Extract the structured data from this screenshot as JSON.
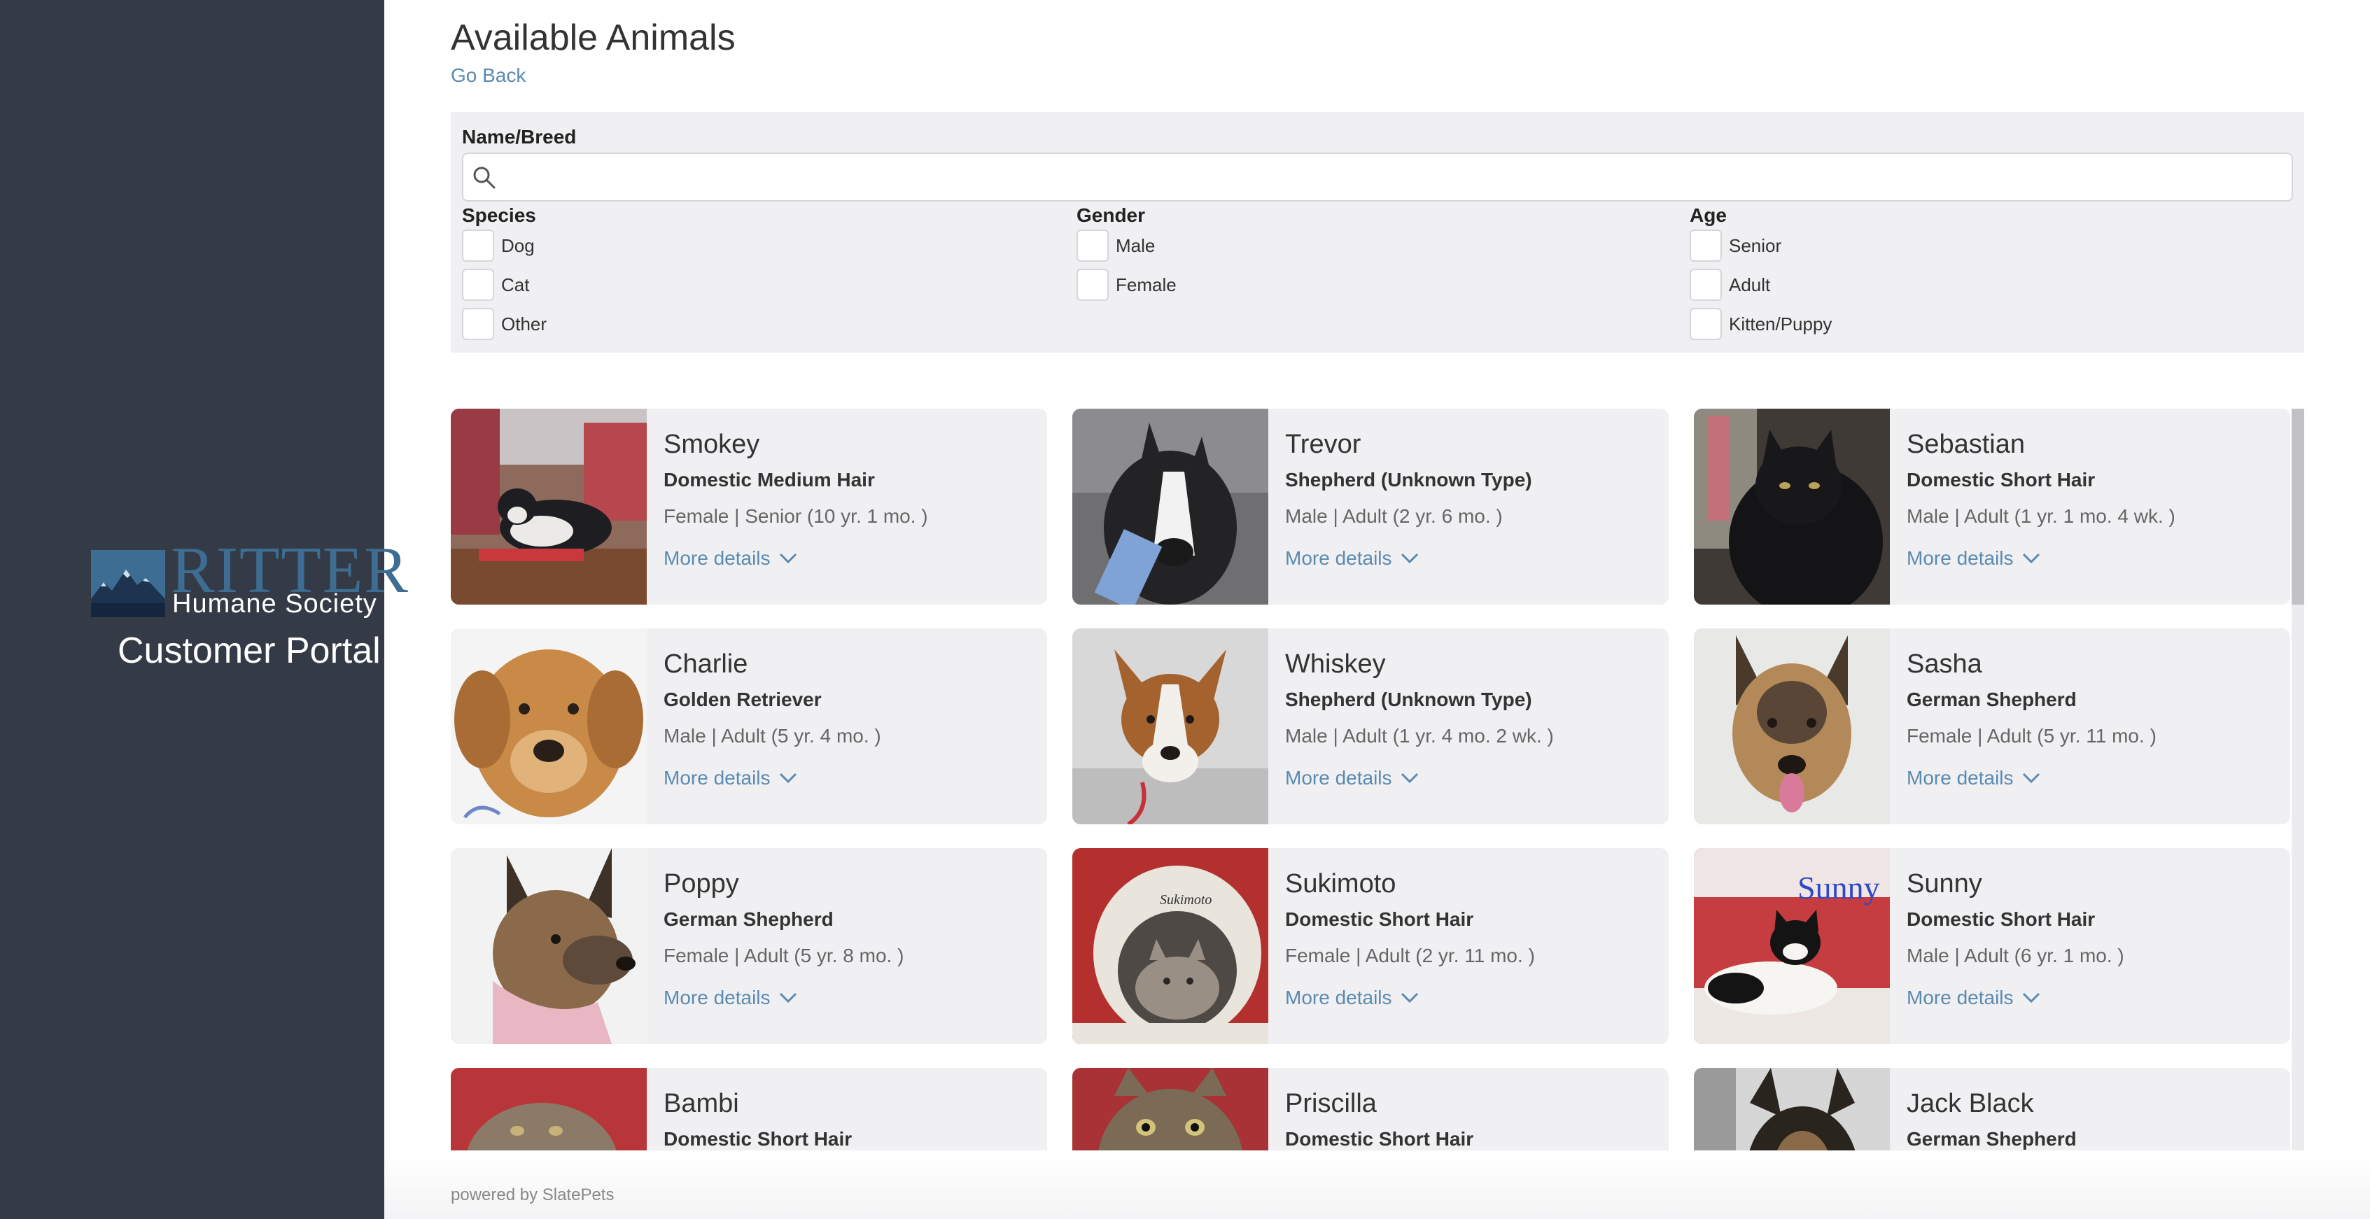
{
  "sidebar": {
    "logo_ritter": "RITTER",
    "logo_humane": "Humane Society",
    "portal_title": "Customer Portal"
  },
  "header": {
    "title": "Available Animals",
    "go_back": "Go Back"
  },
  "filters": {
    "name_breed_label": "Name/Breed",
    "search_placeholder": "",
    "species_label": "Species",
    "species_options": [
      "Dog",
      "Cat",
      "Other"
    ],
    "gender_label": "Gender",
    "gender_options": [
      "Male",
      "Female"
    ],
    "age_label": "Age",
    "age_options": [
      "Senior",
      "Adult",
      "Kitten/Puppy"
    ]
  },
  "more_details_label": "More details",
  "animals": [
    {
      "name": "Smokey",
      "breed": "Domestic Medium Hair",
      "info": "Female | Senior (10 yr. 1 mo. )"
    },
    {
      "name": "Trevor",
      "breed": "Shepherd (Unknown Type)",
      "info": "Male | Adult (2 yr. 6 mo. )"
    },
    {
      "name": "Sebastian",
      "breed": "Domestic Short Hair",
      "info": "Male | Adult (1 yr. 1 mo. 4 wk. )"
    },
    {
      "name": "Charlie",
      "breed": "Golden Retriever",
      "info": "Male | Adult (5 yr. 4 mo. )"
    },
    {
      "name": "Whiskey",
      "breed": "Shepherd (Unknown Type)",
      "info": "Male | Adult (1 yr. 4 mo. 2 wk. )"
    },
    {
      "name": "Sasha",
      "breed": "German Shepherd",
      "info": "Female | Adult (5 yr. 11 mo. )"
    },
    {
      "name": "Poppy",
      "breed": "German Shepherd",
      "info": "Female | Adult (5 yr. 8 mo. )"
    },
    {
      "name": "Sukimoto",
      "breed": "Domestic Short Hair",
      "info": "Female | Adult (2 yr. 11 mo. )"
    },
    {
      "name": "Sunny",
      "breed": "Domestic Short Hair",
      "info": "Male | Adult (6 yr. 1 mo. )"
    },
    {
      "name": "Bambi",
      "breed": "Domestic Short Hair",
      "info": ""
    },
    {
      "name": "Priscilla",
      "breed": "Domestic Short Hair",
      "info": ""
    },
    {
      "name": "Jack Black",
      "breed": "German Shepherd",
      "info": ""
    }
  ],
  "photo_overlays": {
    "sukimoto": "Sukimoto",
    "sunny": "Sunny"
  },
  "footer": {
    "text": "powered by SlatePets"
  },
  "colors": {
    "sidebar": "#343b47",
    "brand_blue": "#3e6d93",
    "link": "#5b8ab0",
    "panel": "#f0f0f3"
  }
}
